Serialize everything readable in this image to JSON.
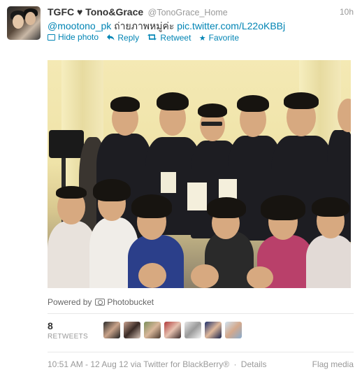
{
  "tweet": {
    "fullname": "TGFC ♥ Tono&Grace",
    "username": "@TonoGrace_Home",
    "time": "10h",
    "mention": "@mootono_pk",
    "text": " ถ่ายภาพหมู่ค่ะ ",
    "link": "pic.twitter.com/L22oKBBj"
  },
  "actions": {
    "hide_photo": "Hide photo",
    "reply": "Reply",
    "retweet": "Retweet",
    "favorite": "Favorite"
  },
  "photo": {
    "powered_by": "Powered by",
    "provider": "Photobucket"
  },
  "stats": {
    "retweet_count": "8",
    "retweet_label": "RETWEETS",
    "retweeter_avatars": [
      "avatar-1",
      "avatar-2",
      "avatar-3",
      "avatar-4",
      "avatar-5",
      "avatar-6",
      "avatar-7"
    ]
  },
  "footer": {
    "timestamp": "10:51 AM - 12 Aug 12",
    "via": "via Twitter for BlackBerry®",
    "details": "Details",
    "flag_media": "Flag media"
  },
  "colors": {
    "link": "#0084b4",
    "muted": "#999999",
    "text": "#333333"
  }
}
